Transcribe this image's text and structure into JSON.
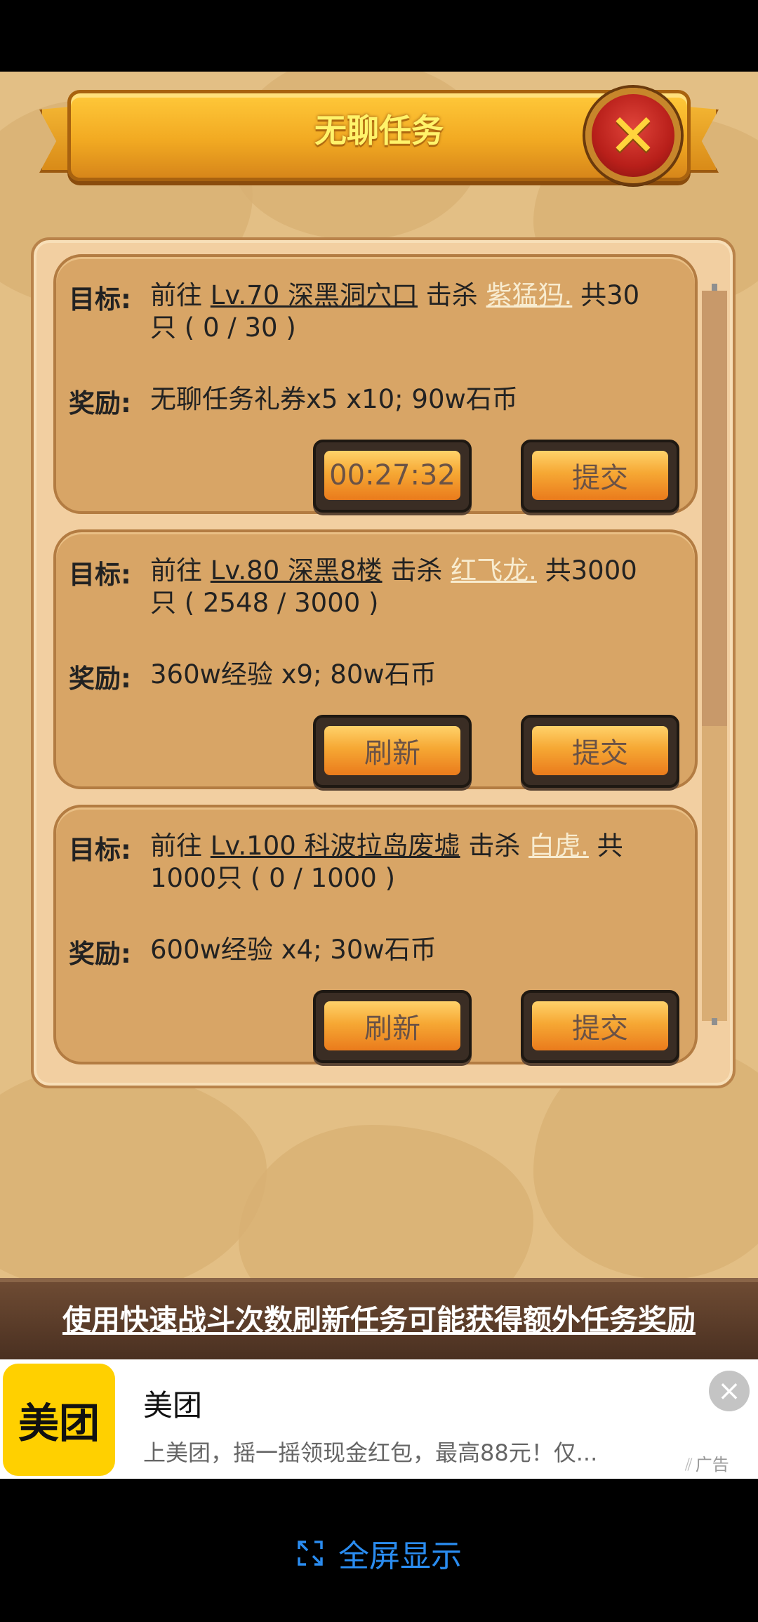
{
  "dialog": {
    "title": "无聊任务",
    "close_icon": "close-x-icon"
  },
  "tasks": [
    {
      "goal_label": "目标:",
      "goal_prefix": "前往",
      "location": "Lv.70 深黑洞穴口",
      "kill_word": "击杀",
      "monster": "紫猛犸.",
      "count_line1": "共30",
      "count_line2": "只 ( 0 / 30 )",
      "reward_label": "奖励:",
      "reward": "无聊任务礼券x5 x10; 90w石币",
      "left_button": "00:27:32",
      "right_button": "提交"
    },
    {
      "goal_label": "目标:",
      "goal_prefix": "前往",
      "location": "Lv.80 深黑8楼",
      "kill_word": "击杀",
      "monster": "红飞龙.",
      "count_line1": "共3000",
      "count_line2": "只 ( 2548 / 3000 )",
      "reward_label": "奖励:",
      "reward": "360w经验 x9; 80w石币",
      "left_button": "刷新",
      "right_button": "提交"
    },
    {
      "goal_label": "目标:",
      "goal_prefix": "前往",
      "location": "Lv.100 科波拉岛废墟",
      "kill_word": "击杀",
      "monster": "白虎.",
      "count_line1": "共",
      "count_line2": "1000只 ( 0 / 1000 )",
      "reward_label": "奖励:",
      "reward": "600w经验 x4; 30w石币",
      "left_button": "刷新",
      "right_button": "提交"
    }
  ],
  "tip": "使用快速战斗次数刷新任务可能获得额外任务奖励",
  "ad": {
    "logo_text": "美团",
    "title": "美团",
    "description": "上美团，摇一摇领现金红包，最高88元！仅...",
    "ad_mark": "广告",
    "close_icon": "close-icon"
  },
  "fullscreen": {
    "label": "全屏显示",
    "icon": "expand-icon"
  },
  "colors": {
    "monster_link": "#f8ecd0",
    "fullscreen_blue": "#2a8cf0",
    "meituan_yellow": "#ffd000"
  }
}
